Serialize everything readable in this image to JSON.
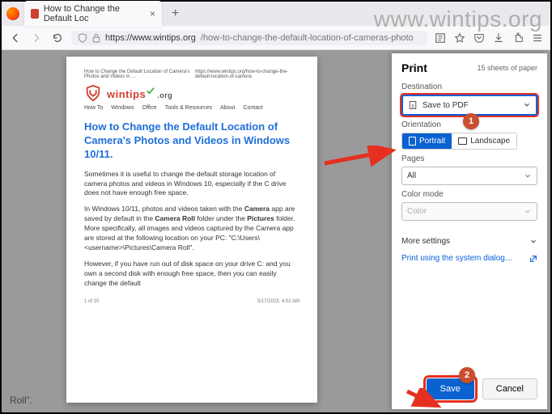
{
  "watermark": "www.wintips.org",
  "tab": {
    "title": "How to Change the Default Loc"
  },
  "url": {
    "scheme_host": "https://www.wintips.org",
    "path": "/how-to-change-the-default-location-of-cameras-photo"
  },
  "preview": {
    "header_left": "How to Change the Default Location of Camera's Photos and Videos in …",
    "header_right": "https://www.wintips.org/how-to-change-the-default-location-of-camera",
    "logo_text": "wintips",
    "logo_ext": ".org",
    "nav": [
      "How To",
      "Windows",
      "Office",
      "Tools & Resources",
      "About",
      "Contact"
    ],
    "title": "How to Change the Default Location of Camera's Photos and Videos in Windows 10/11.",
    "intro": "Sometimes it is useful to change the default storage location of camera photos and videos in Windows 10, especially if the C drive does not have enough free space.",
    "p2_prefix": "In Windows 10/11, photos and videos taken with the ",
    "p2_bold1": "Camera",
    "p2_mid1": " app are saved by default in the ",
    "p2_bold2": "Camera Roll",
    "p2_mid2": " folder under the ",
    "p2_bold3": "Pictures",
    "p2_suffix": " folder. More specifically, all images and videos captured by the Camera app are stored at the following location on your PC: \"C:\\Users\\<username>\\Pictures\\Camera Roll\".",
    "p3": "However, if you have run out of disk space on your drive C: and you own a second disk with enough free space, then you can easily change the default",
    "footer_left": "1 of 15",
    "footer_right": "5/17/2023, 4:02 AM"
  },
  "print": {
    "title": "Print",
    "sheets": "15 sheets of paper",
    "destination_label": "Destination",
    "destination_value": "Save to PDF",
    "orientation_label": "Orientation",
    "orientation_portrait": "Portrait",
    "orientation_landscape": "Landscape",
    "pages_label": "Pages",
    "pages_value": "All",
    "colormode_label": "Color mode",
    "colormode_value": "Color",
    "more_settings": "More settings",
    "system_dialog": "Print using the system dialog…",
    "save": "Save",
    "cancel": "Cancel"
  },
  "badges": {
    "one": "1",
    "two": "2"
  }
}
